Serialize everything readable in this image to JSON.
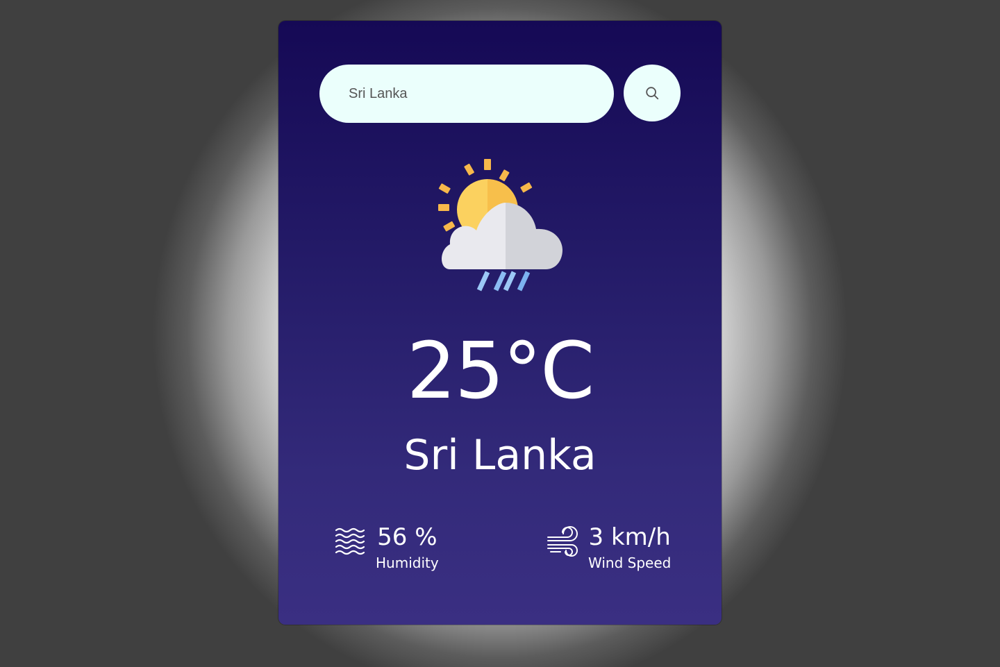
{
  "search": {
    "value": "Sri Lanka",
    "button_icon": "search-icon"
  },
  "weather": {
    "icon": "partly-cloudy-rain-icon",
    "temperature": "25°C",
    "city": "Sri Lanka"
  },
  "details": {
    "humidity": {
      "icon": "humidity-waves-icon",
      "value": "56 %",
      "label": "Humidity"
    },
    "wind": {
      "icon": "wind-icon",
      "value": "3 km/h",
      "label": "Wind Speed"
    }
  },
  "colors": {
    "card_top": "#150955",
    "card_bottom": "#3a2f82",
    "input_background": "#ebfffc",
    "text": "#ffffff"
  }
}
